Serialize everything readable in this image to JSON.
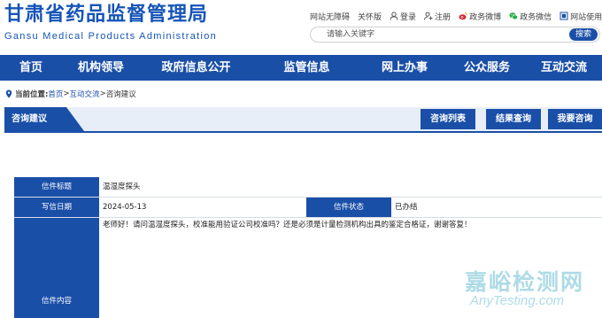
{
  "header": {
    "title_cn": "甘肃省药品监督管理局",
    "title_en": "Gansu Medical Products Administration"
  },
  "top_links": [
    {
      "label": "网站无障碍",
      "icon": "none"
    },
    {
      "label": "关怀版",
      "icon": "none"
    },
    {
      "label": "登录",
      "icon": "user-icon"
    },
    {
      "label": "注册",
      "icon": "register-icon"
    },
    {
      "label": "政务微博",
      "icon": "weibo-icon"
    },
    {
      "label": "政务微信",
      "icon": "wechat-icon"
    },
    {
      "label": "网站使用指南",
      "icon": "guide-icon"
    }
  ],
  "search": {
    "placeholder": "请输入关键字",
    "button_label": "搜索"
  },
  "nav": [
    {
      "label": "首页"
    },
    {
      "label": "机构领导"
    },
    {
      "label": "政府信息公开"
    },
    {
      "label": "监管信息"
    },
    {
      "label": "网上办事"
    },
    {
      "label": "公众服务"
    },
    {
      "label": "互动交流"
    }
  ],
  "breadcrumb": {
    "prefix": "当前位置:",
    "items": [
      "首页",
      "互动交流",
      "咨询建议"
    ],
    "separator": ">"
  },
  "section": {
    "tab_label": "咨询建议",
    "buttons": [
      {
        "label": "咨询列表"
      },
      {
        "label": "结果查询"
      },
      {
        "label": "我要咨询"
      }
    ]
  },
  "letter": {
    "title_label": "信件标题",
    "title_value": "温湿度探头",
    "date_label": "写信日期",
    "date_value": "2024-05-13",
    "status_label": "信件状态",
    "status_value": "已办结",
    "content_label": "信件内容",
    "content_value": "老师好！请问温湿度探头，校准能用验证公司校准吗？还是必须是计量检测机构出具的鉴定合格证，谢谢答复！"
  },
  "watermark": {
    "cn": "嘉峪检测网",
    "en": "AnyTesting.com"
  },
  "colors": {
    "brand_blue": "#1a4fa8",
    "section_bg": "#e8eef7",
    "watermark": "#28a0be"
  }
}
